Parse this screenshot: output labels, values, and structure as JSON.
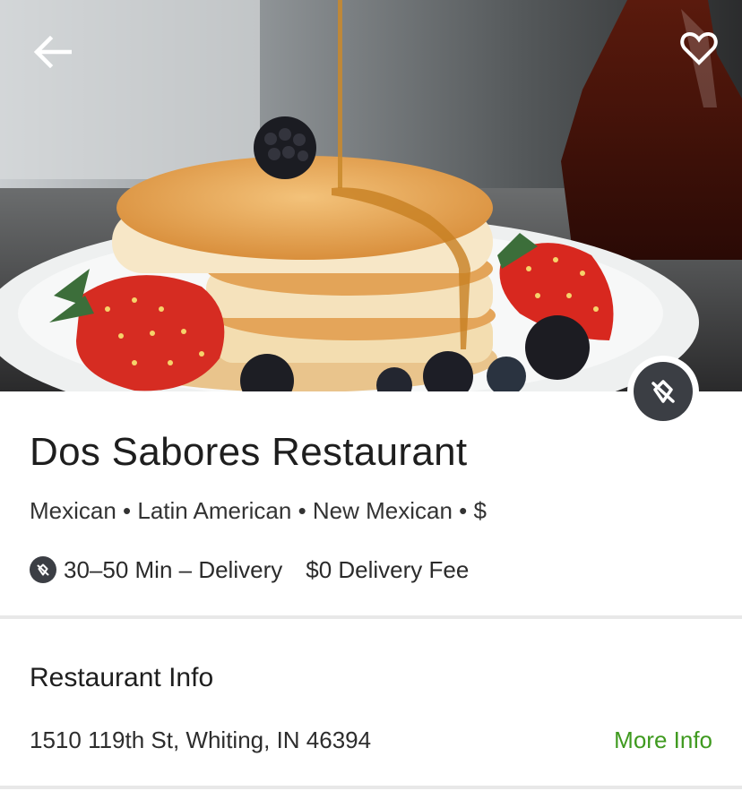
{
  "hero": {
    "image_alt": "pancakes with berries and syrup",
    "back_icon": "arrow-left-icon",
    "favorite_icon": "heart-outline-icon",
    "badge_icon": "location-off-icon"
  },
  "restaurant": {
    "name": "Dos Sabores Restaurant",
    "cuisines": "Mexican • Latin American • New Mexican • $",
    "delivery_time": "30–50 Min – Delivery",
    "delivery_fee": "$0 Delivery Fee"
  },
  "info_section": {
    "title": "Restaurant Info",
    "address": "1510 119th St, Whiting, IN 46394",
    "more_info_label": "More Info"
  },
  "colors": {
    "accent_green": "#3f9a1f",
    "badge_dark": "#3b3e44"
  }
}
